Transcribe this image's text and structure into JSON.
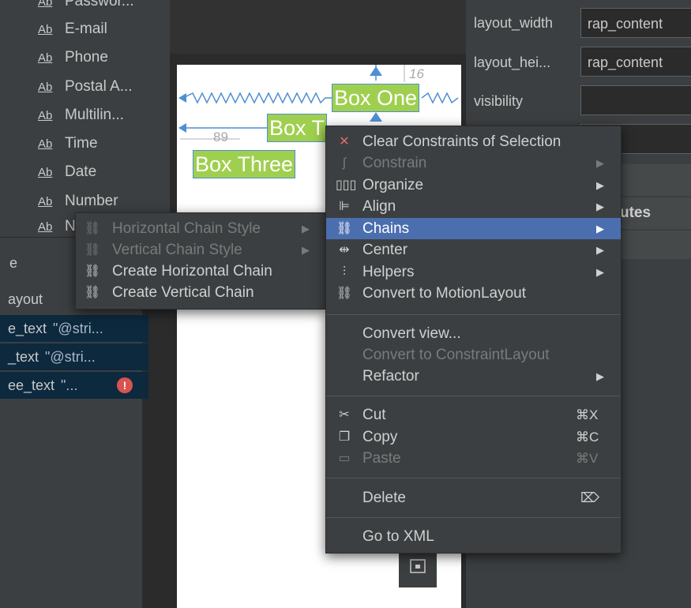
{
  "palette": {
    "items": [
      {
        "label": "Passwor..."
      },
      {
        "label": "E-mail"
      },
      {
        "label": "Phone"
      },
      {
        "label": "Postal A..."
      },
      {
        "label": "Multilin..."
      },
      {
        "label": "Time"
      },
      {
        "label": "Date"
      },
      {
        "label": "Number"
      },
      {
        "label": "N"
      }
    ],
    "item_icon": "Ab"
  },
  "tree": {
    "header": "e",
    "layout_label": "ayout",
    "rows": [
      {
        "name": "e_text",
        "value": "\"@stri..."
      },
      {
        "name": "_text",
        "value": "\"@stri..."
      },
      {
        "name": "ee_text",
        "value": "\"..."
      }
    ],
    "error_icon": "!"
  },
  "canvas": {
    "margin_top": "16",
    "margin_left": "89",
    "widgets": [
      "Box One",
      "Box T",
      "Box Three"
    ]
  },
  "attributes": {
    "rows": [
      {
        "label": "layout_width",
        "value": "rap_content"
      },
      {
        "label": "layout_hei...",
        "value": "rap_content"
      },
      {
        "label": "visibility",
        "value": ""
      }
    ],
    "section_partial": "utes"
  },
  "submenu": {
    "items": [
      {
        "label": "Horizontal Chain Style",
        "disabled": true
      },
      {
        "label": "Vertical Chain Style",
        "disabled": true
      },
      {
        "label": "Create Horizontal Chain",
        "disabled": false
      },
      {
        "label": "Create Vertical Chain",
        "disabled": false
      }
    ]
  },
  "context_menu": {
    "items": [
      {
        "label": "Clear Constraints of Selection"
      },
      {
        "label": "Constrain"
      },
      {
        "label": "Organize"
      },
      {
        "label": "Align"
      },
      {
        "label": "Chains"
      },
      {
        "label": "Center"
      },
      {
        "label": "Helpers"
      },
      {
        "label": "Convert to MotionLayout"
      },
      {
        "label": "Convert view..."
      },
      {
        "label": "Convert to ConstraintLayout"
      },
      {
        "label": "Refactor"
      },
      {
        "label": "Cut",
        "shortcut": "⌘X"
      },
      {
        "label": "Copy",
        "shortcut": "⌘C"
      },
      {
        "label": "Paste",
        "shortcut": "⌘V"
      },
      {
        "label": "Delete",
        "shortcut": "⌦"
      },
      {
        "label": "Go to XML"
      }
    ],
    "highlight_color": "#4b6eaf"
  },
  "colors": {
    "widget_green": "#9fcf4e",
    "constraint_blue": "#4f8fd0",
    "error_red": "#d9534f"
  }
}
